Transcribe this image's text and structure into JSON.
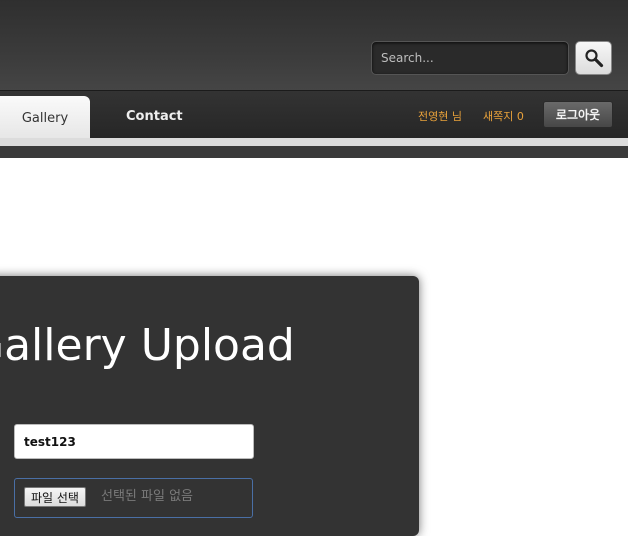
{
  "header": {
    "search_placeholder": "Search...",
    "search_button_icon": "magnifier-icon"
  },
  "nav": {
    "items": [
      {
        "label": "Gallery",
        "active": true
      },
      {
        "label": "Contact",
        "active": false
      }
    ],
    "user_label": "전영현 님",
    "messages_label": "새쪽지 0",
    "logout_label": "로그아웃"
  },
  "upload": {
    "title": "Gallery Upload",
    "title_input_value": "test123",
    "file_button_label": "파일 선택",
    "file_status": "선택된 파일 없음"
  },
  "colors": {
    "accent_orange": "#e8a13a",
    "panel_bg": "#333333",
    "header_bg": "#3b3b3b"
  }
}
